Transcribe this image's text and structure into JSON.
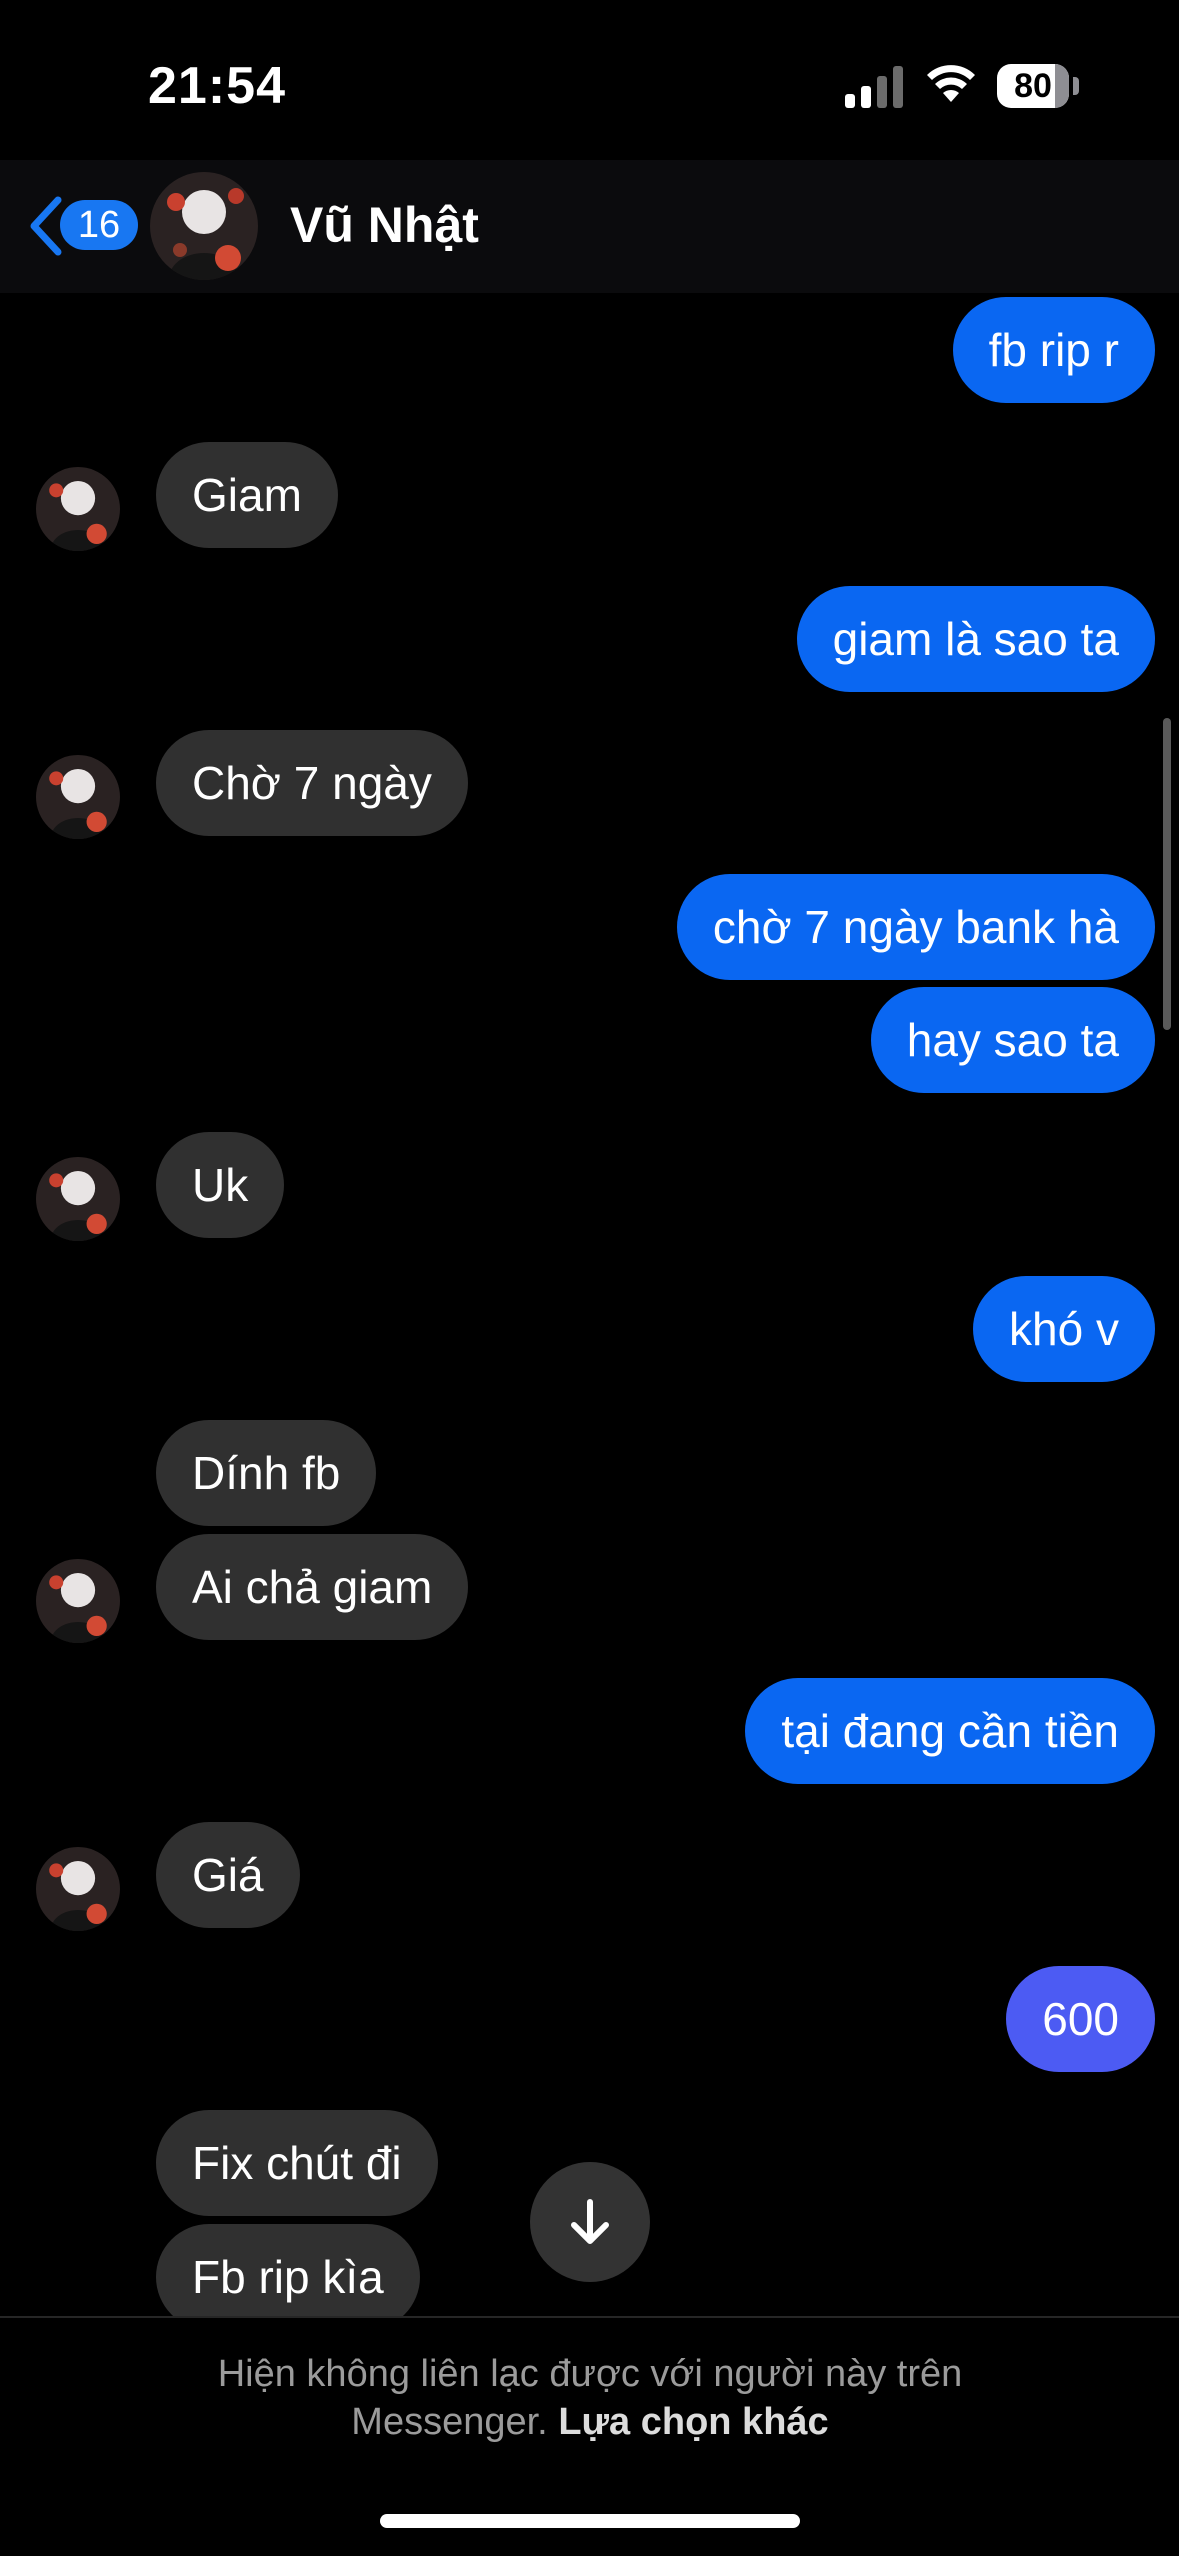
{
  "status_bar": {
    "time": "21:54",
    "battery": "80",
    "icons": [
      "cellular-signal-icon",
      "wifi-icon",
      "battery-icon"
    ]
  },
  "header": {
    "back_badge": "16",
    "contact_name": "Vũ Nhật",
    "icons": [
      "chevron-left-icon",
      "avatar"
    ]
  },
  "messages": [
    {
      "sender": "me",
      "text": "fb rip r"
    },
    {
      "sender": "them",
      "text": "Giam"
    },
    {
      "sender": "me",
      "text": "giam là sao ta"
    },
    {
      "sender": "them",
      "text": "Chờ 7 ngày"
    },
    {
      "sender": "me",
      "text": "chờ 7 ngày bank hà"
    },
    {
      "sender": "me",
      "text": "hay sao ta"
    },
    {
      "sender": "them",
      "text": "Uk"
    },
    {
      "sender": "me",
      "text": "khó v"
    },
    {
      "sender": "them",
      "text": "Dính fb"
    },
    {
      "sender": "them",
      "text": "Ai chả giam"
    },
    {
      "sender": "me",
      "text": "tại đang cần tiền"
    },
    {
      "sender": "them",
      "text": "Giá"
    },
    {
      "sender": "me",
      "text": "600"
    },
    {
      "sender": "them",
      "text": "Fix chút đi"
    },
    {
      "sender": "them",
      "text": "Fb rip kìa"
    }
  ],
  "footer": {
    "notice_line1": "Hiện không liên lạc được với người này trên",
    "notice_line2": "Messenger.",
    "notice_link": "Lựa chọn khác"
  },
  "colors": {
    "background": "#000000",
    "outgoing_bubble": "#0a67f2",
    "outgoing_bubble_alt": "#4c5bf3",
    "incoming_bubble": "#303030",
    "badge": "#1877f2"
  }
}
